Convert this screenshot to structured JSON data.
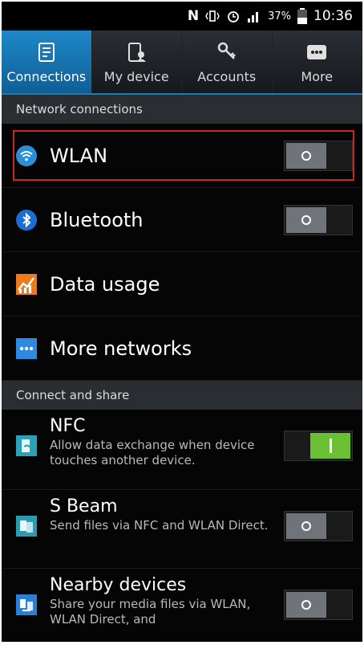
{
  "status": {
    "carrier_icon": "N",
    "battery": "37%",
    "time": "10:36"
  },
  "tabs": [
    {
      "label": "Connections"
    },
    {
      "label": "My device"
    },
    {
      "label": "Accounts"
    },
    {
      "label": "More"
    }
  ],
  "sections": {
    "network": "Network connections",
    "share": "Connect and share"
  },
  "network_rows": [
    {
      "label": "WLAN",
      "toggle": "off"
    },
    {
      "label": "Bluetooth",
      "toggle": "off"
    },
    {
      "label": "Data usage"
    },
    {
      "label": "More networks"
    }
  ],
  "share_rows": [
    {
      "title": "NFC",
      "desc": "Allow data exchange when device touches another device.",
      "toggle": "on"
    },
    {
      "title": "S Beam",
      "desc": "Send files via NFC and WLAN Direct.",
      "toggle": "off"
    },
    {
      "title": "Nearby devices",
      "desc": "Share your media files via WLAN, WLAN Direct, and",
      "toggle": "off"
    }
  ],
  "colors": {
    "accent": "#1f87c8",
    "toggle_on": "#6abf33",
    "highlight": "#c62828"
  }
}
